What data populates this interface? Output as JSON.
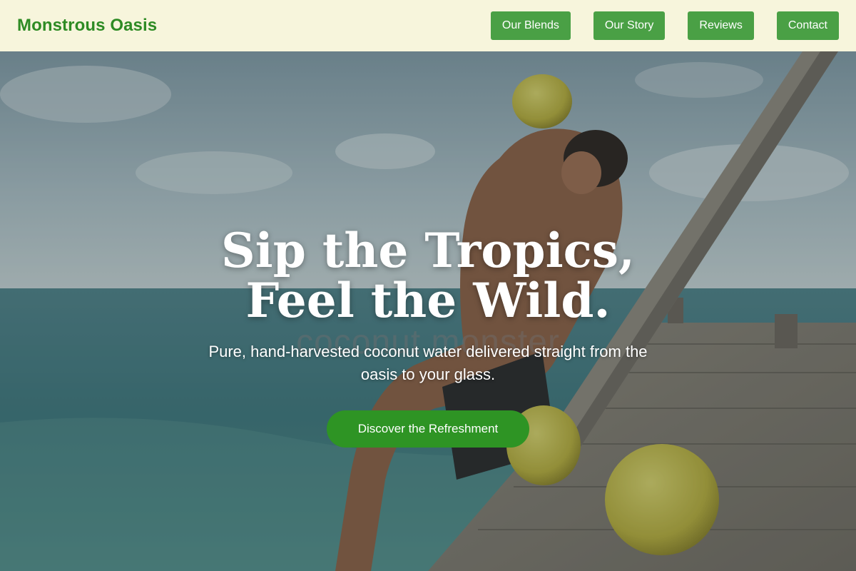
{
  "brand": {
    "name": "Monstrous Oasis",
    "color": "#2e8b24"
  },
  "nav": {
    "items": [
      {
        "label": "Our Blends"
      },
      {
        "label": "Our Story"
      },
      {
        "label": "Reviews"
      },
      {
        "label": "Contact"
      }
    ],
    "button_color": "#4aa045"
  },
  "hero": {
    "title_line1": "Sip the Tropics,",
    "title_line2": "Feel the Wild.",
    "watermark": "coconut monster",
    "subtitle": "Pure, hand-harvested coconut water delivered straight from the oasis to your glass.",
    "cta_label": "Discover the Refreshment",
    "cta_color": "#2e9424",
    "photo_description": "man drinking from a green coconut on a wooden pier by the sea"
  },
  "colors": {
    "header_bg": "#f7f5dc"
  }
}
